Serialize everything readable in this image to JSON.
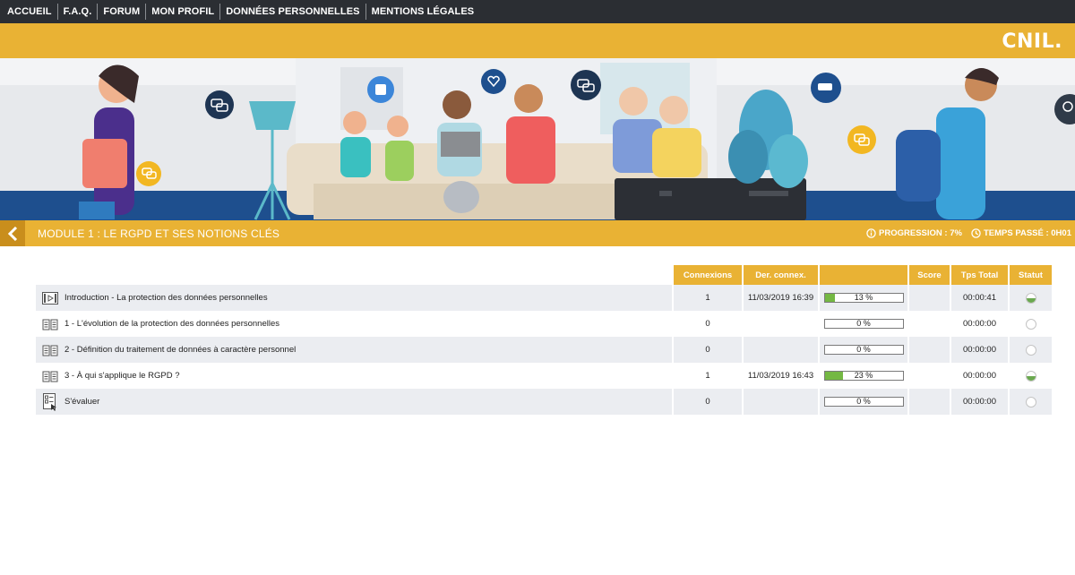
{
  "nav": {
    "items": [
      "ACCUEIL",
      "F.A.Q.",
      "FORUM",
      "MON PROFIL",
      "DONNÉES PERSONNELLES",
      "MENTIONS LÉGALES"
    ]
  },
  "brand": {
    "logo": "CNIL."
  },
  "module": {
    "title": "MODULE 1 : LE RGPD ET SES NOTIONS CLÉS",
    "progress_label": "PROGRESSION : 7%",
    "time_label": "TEMPS PASSÉ : 0H01"
  },
  "table": {
    "headers": [
      "Connexions",
      "Der. connex.",
      "",
      "Score",
      "Tps Total",
      "Statut"
    ],
    "rows": [
      {
        "icon": "video-icon",
        "name": "Introduction - La protection des données personnelles",
        "connexions": "1",
        "last": "11/03/2019 16:39",
        "progress": 13,
        "progress_label": "13 %",
        "score": "",
        "time": "00:00:41",
        "status": "partial"
      },
      {
        "icon": "book-icon",
        "name": "1 - L'évolution de la protection des données personnelles",
        "connexions": "0",
        "last": "",
        "progress": 0,
        "progress_label": "0 %",
        "score": "",
        "time": "00:00:00",
        "status": "none"
      },
      {
        "icon": "book-icon",
        "name": "2 - Définition du traitement de données à caractère personnel",
        "connexions": "0",
        "last": "",
        "progress": 0,
        "progress_label": "0 %",
        "score": "",
        "time": "00:00:00",
        "status": "none"
      },
      {
        "icon": "book-icon",
        "name": "3 - À qui s'applique le RGPD ?",
        "connexions": "1",
        "last": "11/03/2019 16:43",
        "progress": 23,
        "progress_label": "23 %",
        "score": "",
        "time": "00:00:00",
        "status": "partial"
      },
      {
        "icon": "quiz-icon",
        "name": "S'évaluer",
        "connexions": "0",
        "last": "",
        "progress": 0,
        "progress_label": "0 %",
        "score": "",
        "time": "00:00:00",
        "status": "none"
      }
    ]
  },
  "colors": {
    "accent": "#e9b234",
    "nav_bg": "#2b2e33",
    "progress_fill": "#74b843",
    "row_alt": "#ebedf1"
  }
}
